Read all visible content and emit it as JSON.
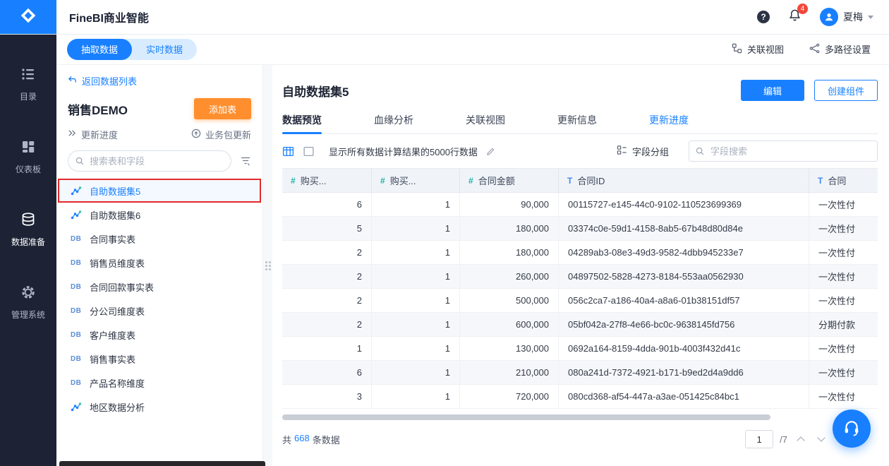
{
  "colors": {
    "accent": "#1880ff",
    "orange": "#ff8f2e",
    "annotation_red": "#e12a2a",
    "sidebar_bg": "#1d2335",
    "number_field": "#1fb3a6",
    "text_field": "#3f8cf0"
  },
  "topbar": {
    "app_title": "FineBI商业智能",
    "notification_count": "4",
    "user_name": "夏梅"
  },
  "sidenav": {
    "items": [
      {
        "key": "catalog",
        "label": "目录",
        "icon": "catalog-icon",
        "active": false
      },
      {
        "key": "dashboard",
        "label": "仪表板",
        "icon": "dashboard-icon",
        "active": false
      },
      {
        "key": "data-prep",
        "label": "数据准备",
        "icon": "database-icon",
        "active": true
      },
      {
        "key": "admin",
        "label": "管理系统",
        "icon": "gear-icon",
        "active": false
      }
    ]
  },
  "mode_bar": {
    "tabs": [
      {
        "label": "抽取数据",
        "active": true
      },
      {
        "label": "实时数据",
        "active": false
      }
    ],
    "actions": [
      {
        "label": "关联视图",
        "icon": "relation-view-icon"
      },
      {
        "label": "多路径设置",
        "icon": "multipath-icon"
      }
    ]
  },
  "package_panel": {
    "back_label": "返回数据列表",
    "title": "销售DEMO",
    "add_table_label": "添加表",
    "update_progress_label": "更新进度",
    "package_update_label": "业务包更新",
    "search_placeholder": "搜索表和字段",
    "items": [
      {
        "label": "自助数据集5",
        "type": "dataset",
        "selected": true,
        "annotated": true
      },
      {
        "label": "自助数据集6",
        "type": "dataset",
        "selected": false,
        "annotated": false
      },
      {
        "label": "合同事实表",
        "type": "db",
        "selected": false,
        "annotated": false
      },
      {
        "label": "销售员维度表",
        "type": "db",
        "selected": false,
        "annotated": false
      },
      {
        "label": "合同回款事实表",
        "type": "db",
        "selected": false,
        "annotated": false
      },
      {
        "label": "分公司维度表",
        "type": "db",
        "selected": false,
        "annotated": false
      },
      {
        "label": "客户维度表",
        "type": "db",
        "selected": false,
        "annotated": false
      },
      {
        "label": "销售事实表",
        "type": "db",
        "selected": false,
        "annotated": false
      },
      {
        "label": "产品名称维度",
        "type": "db",
        "selected": false,
        "annotated": false
      },
      {
        "label": "地区数据分析",
        "type": "dataset",
        "selected": false,
        "annotated": false
      }
    ]
  },
  "main": {
    "title": "自助数据集5",
    "buttons": {
      "edit": "编辑",
      "create": "创建组件"
    },
    "tabs": [
      {
        "label": "数据预览",
        "active": true
      },
      {
        "label": "血缘分析",
        "active": false
      },
      {
        "label": "关联视图",
        "active": false
      },
      {
        "label": "更新信息",
        "active": false
      },
      {
        "label": "更新进度",
        "active": false,
        "link": true
      }
    ],
    "toolbar": {
      "row_info": "显示所有数据计算结果的5000行数据",
      "field_group_label": "字段分组",
      "field_search_placeholder": "字段搜索"
    },
    "table": {
      "columns": [
        {
          "label": "购买...",
          "type": "number"
        },
        {
          "label": "购买...",
          "type": "number"
        },
        {
          "label": "合同金额",
          "type": "number"
        },
        {
          "label": "合同ID",
          "type": "text"
        },
        {
          "label": "合同",
          "type": "text"
        }
      ],
      "rows": [
        [
          "6",
          "1",
          "90,000",
          "00115727-e145-44c0-9102-110523699369",
          "一次性付"
        ],
        [
          "5",
          "1",
          "180,000",
          "03374c0e-59d1-4158-8ab5-67b48d80d84e",
          "一次性付"
        ],
        [
          "2",
          "1",
          "180,000",
          "04289ab3-08e3-49d3-9582-4dbb945233e7",
          "一次性付"
        ],
        [
          "2",
          "1",
          "260,000",
          "04897502-5828-4273-8184-553aa0562930",
          "一次性付"
        ],
        [
          "2",
          "1",
          "500,000",
          "056c2ca7-a186-40a4-a8a6-01b38151df57",
          "一次性付"
        ],
        [
          "2",
          "1",
          "600,000",
          "05bf042a-27f8-4e66-bc0c-9638145fd756",
          "分期付款"
        ],
        [
          "1",
          "1",
          "130,000",
          "0692a164-8159-4dda-901b-4003f432d41c",
          "一次性付"
        ],
        [
          "6",
          "1",
          "210,000",
          "080a241d-7372-4921-b171-b9ed2d4a9dd6",
          "一次性付"
        ],
        [
          "3",
          "1",
          "720,000",
          "080cd368-af54-447a-a3ae-051425c84bc1",
          "一次性付"
        ]
      ]
    },
    "footer": {
      "total_prefix": "共",
      "total_count": "668",
      "total_suffix": "条数据",
      "page_value": "1",
      "page_total_label": "/7"
    }
  }
}
